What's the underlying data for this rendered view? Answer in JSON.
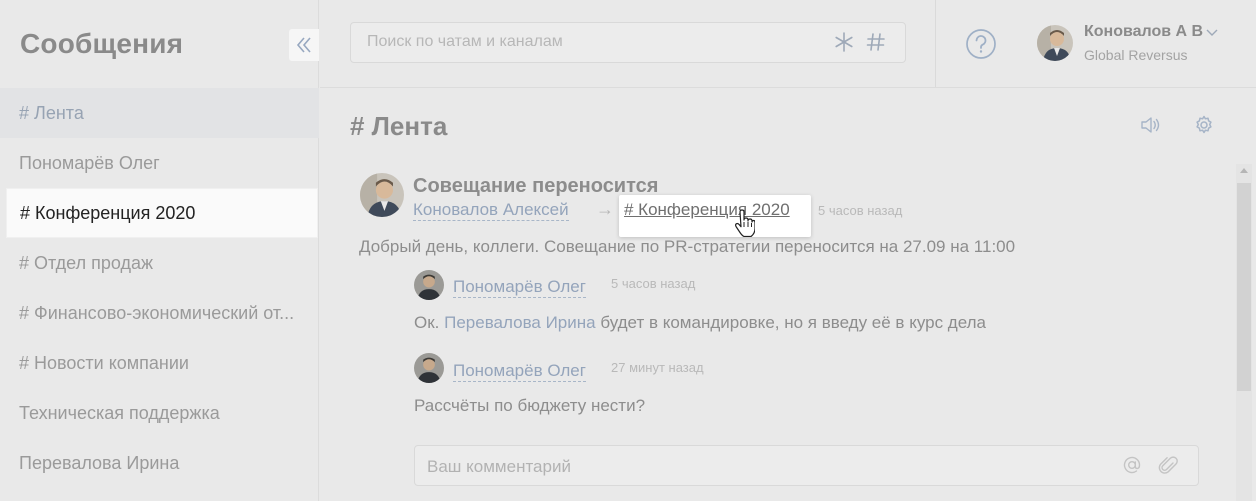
{
  "sidebar": {
    "title": "Сообщения",
    "items": [
      {
        "label": "# Лента"
      },
      {
        "label": "Пономарёв Олег"
      },
      {
        "label": "# Конференция 2020"
      },
      {
        "label": "# Отдел продаж"
      },
      {
        "label": "# Финансово-экономический от..."
      },
      {
        "label": "# Новости компании"
      },
      {
        "label": "Техническая поддержка"
      },
      {
        "label": "Перевалова Ирина"
      }
    ],
    "active_index": 2
  },
  "header": {
    "search_placeholder": "Поиск по чатам и каналам",
    "user": {
      "name": "Коновалов А В",
      "org": "Global Reversus"
    }
  },
  "channel": {
    "title": "# Лента"
  },
  "post": {
    "title": "Совещание переносится",
    "author": "Коновалов Алексей",
    "arrow": "→",
    "channel_link": "# Конференция 2020",
    "time": "5 часов назад",
    "text": "Добрый день, коллеги. Совещание по PR-стратегии переносится на 27.09 на 11:00"
  },
  "replies": [
    {
      "author": "Пономарёв Олег",
      "time": "5 часов назад",
      "text_prefix": "Ок.",
      "mention": "Перевалова Ирина",
      "text_suffix": "будет в командировке, но я введу её в курс дела"
    },
    {
      "author": "Пономарёв Олег",
      "time": "27 минут назад",
      "text": "Рассчёты по бюджету нести?"
    }
  ],
  "comment": {
    "placeholder": "Ваш комментарий"
  },
  "colors": {
    "accent_link": "#94a4bb",
    "background": "#e9e9e9",
    "active_item": "#fafafa"
  }
}
